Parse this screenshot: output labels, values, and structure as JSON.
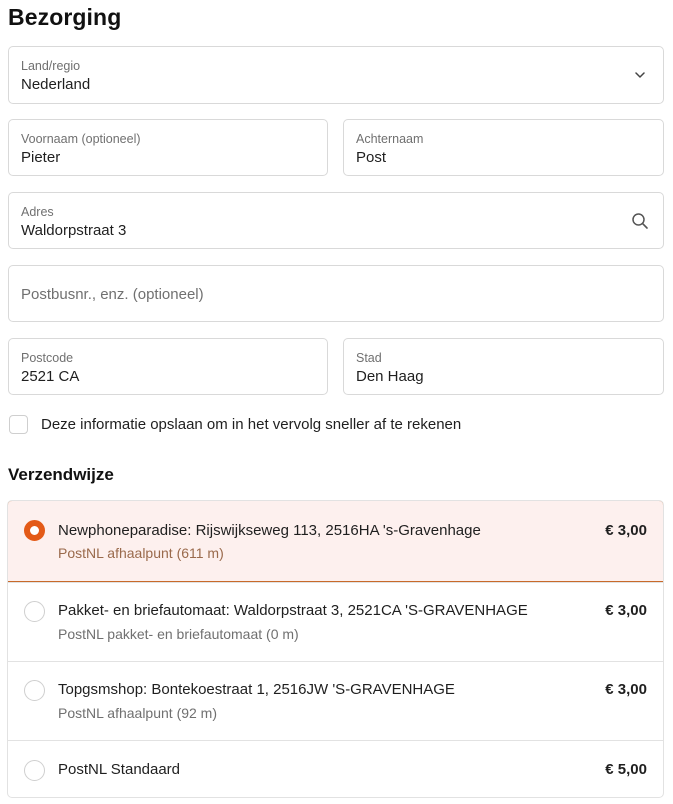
{
  "page": {
    "title": "Bezorging"
  },
  "fields": {
    "country": {
      "label": "Land/regio",
      "value": "Nederland",
      "icon": "chevron-down-icon"
    },
    "first_name": {
      "label": "Voornaam (optioneel)",
      "value": "Pieter"
    },
    "last_name": {
      "label": "Achternaam",
      "value": "Post"
    },
    "address": {
      "label": "Adres",
      "value": "Waldorpstraat 3",
      "icon": "search-icon"
    },
    "address2": {
      "placeholder": "Postbusnr., enz. (optioneel)"
    },
    "postcode": {
      "label": "Postcode",
      "value": "2521 CA"
    },
    "city": {
      "label": "Stad",
      "value": "Den Haag"
    }
  },
  "save_info": {
    "label": "Deze informatie opslaan om in het vervolg sneller af te rekenen",
    "checked": false
  },
  "shipping": {
    "title": "Verzendwijze",
    "accent_color": "#e35a17",
    "options": [
      {
        "name": "Newphoneparadise: Rijswijkseweg 113, 2516HA 's-Gravenhage",
        "sub": "PostNL afhaalpunt (611 m)",
        "price": "€ 3,00",
        "selected": true
      },
      {
        "name": "Pakket- en briefautomaat: Waldorpstraat 3, 2521CA 'S-GRAVENHAGE",
        "sub": "PostNL pakket- en briefautomaat (0 m)",
        "price": "€ 3,00",
        "selected": false
      },
      {
        "name": "Topgsmshop: Bontekoestraat 1, 2516JW 'S-GRAVENHAGE",
        "sub": "PostNL afhaalpunt (92 m)",
        "price": "€ 3,00",
        "selected": false
      },
      {
        "name": "PostNL Standaard",
        "sub": "",
        "price": "€ 5,00",
        "selected": false
      }
    ]
  }
}
